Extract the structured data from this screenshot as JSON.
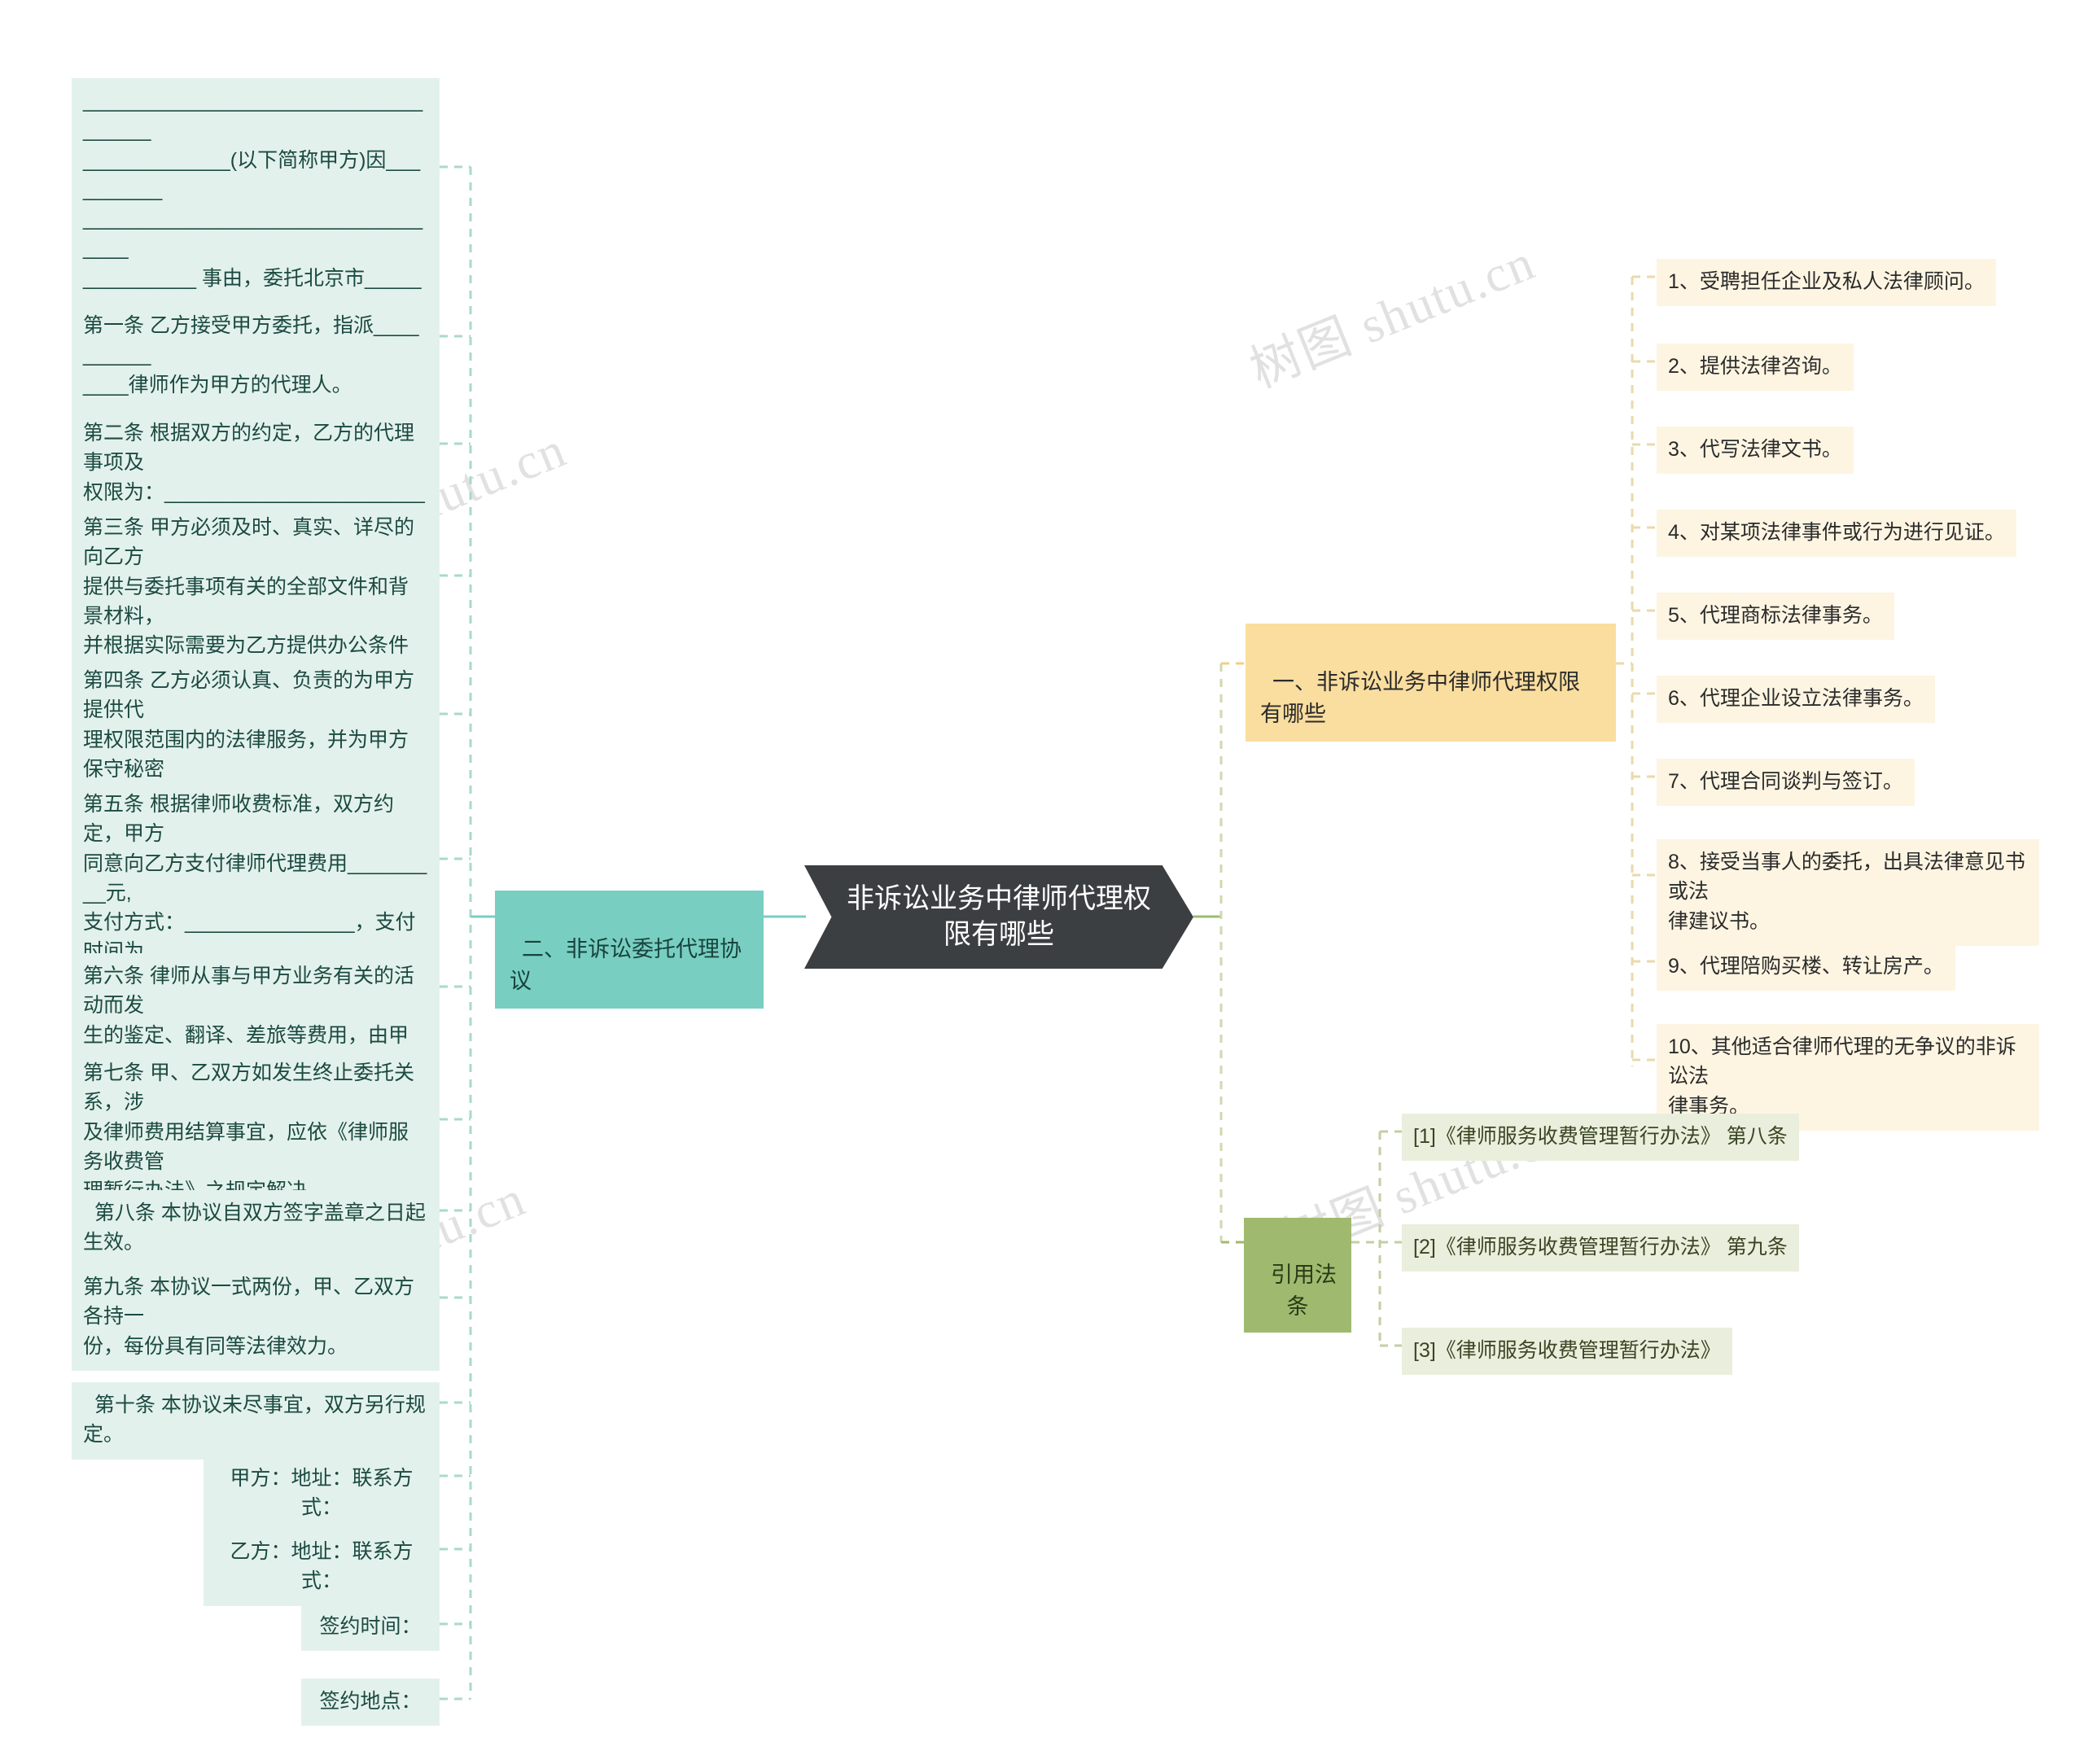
{
  "root": {
    "title": "非诉讼业务中律师代理权限有哪些"
  },
  "watermarks": [
    "树图 shutu.cn",
    "树图 shutu.cn",
    "树图 shutu.cn",
    "树图 shutu.cn"
  ],
  "colors": {
    "root_bg": "#3c3f41",
    "left_branch": "#79cec2",
    "left_leaf": "#e3f1ec",
    "right_branch": "#fade9f",
    "right_leaf": "#fdf5e2",
    "citation_branch": "#9fba6e",
    "citation_leaf": "#eaefdd"
  },
  "left_branch": {
    "label": "二、非诉讼委托代理协议",
    "items": [
      "____________________________________\n_____________(以下简称甲方)因__________\n__________________________________\n__________ 事由，委托北京市___________\n__________________________________\n____律师事务所(以下简称乙方)的律师代理，\n经双方协商，订立下列协议，共同遵守。",
      "第一条 乙方接受甲方委托，指派__________\n____律师作为甲方的代理人。",
      "第二条 根据双方的约定，乙方的代理事项及\n权限为：________________________",
      "第三条 甲方必须及时、真实、详尽的向乙方\n提供与委托事项有关的全部文件和背景材料，\n并根据实际需要为乙方提供办公条件和其他便\n利条件。",
      "第四条 乙方必须认真、负责的为甲方提供代\n理权限范围内的法律服务，并为甲方保守秘密\n。",
      "第五条 根据律师收费标准，双方约定，甲方\n同意向乙方支付律师代理费用_________元,\n支付方式：_______________，支付时间为\n：______________。",
      "第六条 律师从事与甲方业务有关的活动而发\n生的鉴定、翻译、差旅等费用，由甲方支付。",
      "第七条 甲、乙双方如发生终止委托关系，涉\n及律师费用结算事宜，应依《律师服务收费管\n理暂行办法》之规定解决。",
      "  第八条 本协议自双方签字盖章之日起生效。",
      "第九条 本协议一式两份，甲、乙双方各持一\n份，每份具有同等法律效力。",
      "  第十条 本协议未尽事宜，双方另行规定。",
      "甲方：地址：联系方式：",
      "乙方：地址：联系方式：",
      "签约时间：",
      "签约地点："
    ]
  },
  "right_branch": {
    "label": "一、非诉讼业务中律师代理权限有哪些",
    "items": [
      "1、受聘担任企业及私人法律顾问。",
      "2、提供法律咨询。",
      "3、代写法律文书。",
      "4、对某项法律事件或行为进行见证。",
      "5、代理商标法律事务。",
      "6、代理企业设立法律事务。",
      "7、代理合同谈判与签订。",
      "8、接受当事人的委托，出具法律意见书或法\n律建议书。",
      "9、代理陪购买楼、转让房产。",
      "10、其他适合律师代理的无争议的非诉讼法\n律事务。"
    ]
  },
  "citation_branch": {
    "label": "引用法条",
    "items": [
      "[1]《律师服务收费管理暂行办法》 第八条",
      "[2]《律师服务收费管理暂行办法》 第九条",
      "[3]《律师服务收费管理暂行办法》"
    ]
  }
}
